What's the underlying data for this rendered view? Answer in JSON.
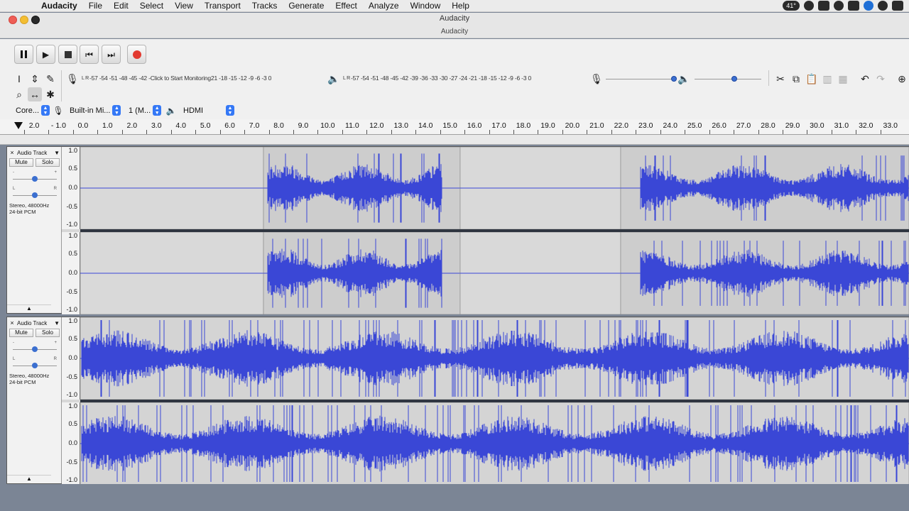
{
  "menubar": {
    "app": "Audacity",
    "items": [
      "File",
      "Edit",
      "Select",
      "View",
      "Transport",
      "Tracks",
      "Generate",
      "Effect",
      "Analyze",
      "Window",
      "Help"
    ],
    "status_badge": "41°"
  },
  "window": {
    "title": "Audacity",
    "subtitle": "Audacity"
  },
  "meters": {
    "record_prefix": "L\nR",
    "record_scale": "-57 -54 -51 -48 -45 -42 -",
    "record_prompt": "Click to Start Monitoring",
    "record_scale_tail": "21 -18 -15 -12 -9 -6 -3 0",
    "play_scale": "-57 -54 -51 -48 -45 -42 -39 -36 -33 -30 -27 -24 -21 -18 -15 -12 -9 -6 -3 0"
  },
  "devices": {
    "host": "Core...",
    "input": "Built-in Mi...",
    "channels": "1 (M...",
    "output": "HDMI"
  },
  "ruler": {
    "labels": [
      "2.0",
      "- 1.0",
      "0.0",
      "1.0",
      "2.0",
      "3.0",
      "4.0",
      "5.0",
      "6.0",
      "7.0",
      "8.0",
      "9.0",
      "10.0",
      "11.0",
      "12.0",
      "13.0",
      "14.0",
      "15.0",
      "16.0",
      "17.0",
      "18.0",
      "19.0",
      "20.0",
      "21.0",
      "22.0",
      "23.0",
      "24.0",
      "25.0",
      "26.0",
      "27.0",
      "28.0",
      "29.0",
      "30.0",
      "31.0",
      "32.0",
      "33.0"
    ]
  },
  "tracks": [
    {
      "name": "Audio Track",
      "mute": "Mute",
      "solo": "Solo",
      "format_line1": "Stereo, 48000Hz",
      "format_line2": "24-bit PCM",
      "collapse_glyph": "▲",
      "close_glyph": "×",
      "menu_glyph": "▼",
      "gain_minus": "-",
      "gain_plus": "+",
      "pan_left": "L",
      "pan_right": "R",
      "scale": [
        "1.0",
        "0.5",
        "0.0",
        "-0.5",
        "-1.0"
      ]
    },
    {
      "name": "Audio Track",
      "mute": "Mute",
      "solo": "Solo",
      "format_line1": "Stereo, 48000Hz",
      "format_line2": "24-bit PCM",
      "collapse_glyph": "▲",
      "close_glyph": "×",
      "menu_glyph": "▼",
      "gain_minus": "-",
      "gain_plus": "+",
      "pan_left": "L",
      "pan_right": "R",
      "scale": [
        "1.0",
        "0.5",
        "0.0",
        "-0.5",
        "-1.0"
      ]
    }
  ],
  "icons": {
    "apple": "",
    "pause": "pause-icon",
    "play": "▶",
    "stop": "stop-icon",
    "skip_start": "⏮",
    "skip_end": "⏭",
    "record": "record-icon",
    "select_tool": "I",
    "envelope_tool": "⇕",
    "draw_tool": "✎",
    "zoom_tool": "⌕",
    "timeshift_tool": "↔",
    "multi_tool": "✱",
    "mic": "🎙",
    "speaker": "🔈",
    "cut": "✂",
    "copy": "⧉",
    "paste": "📋",
    "undo": "↶",
    "redo": "↷",
    "zoom_in": "⊕"
  },
  "colors": {
    "waveform": "#3a47d6",
    "record": "#e23a30",
    "accent": "#3478f6"
  }
}
